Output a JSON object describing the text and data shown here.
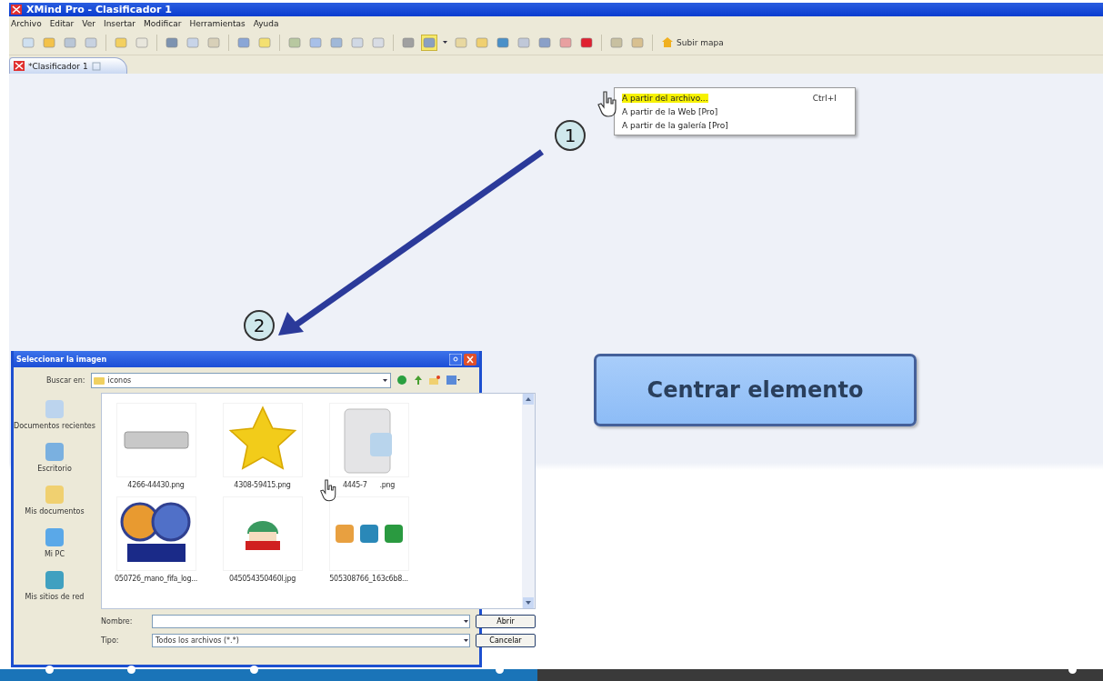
{
  "window": {
    "title": "XMind Pro - Clasificador 1"
  },
  "menu_bar": [
    "Archivo",
    "Editar",
    "Ver",
    "Insertar",
    "Modificar",
    "Herramientas",
    "Ayuda"
  ],
  "toolbar": {
    "image_button_selected": true,
    "subir_mapa": "Subir mapa"
  },
  "tabs": [
    {
      "label": "*Clasificador 1",
      "selected": true
    }
  ],
  "image_menu": {
    "items": [
      {
        "label": "A partir del archivo...",
        "shortcut": "Ctrl+I",
        "selected": true
      },
      {
        "label": "A partir de la Web [Pro]",
        "selected": false
      },
      {
        "label": "A partir de la galería [Pro]",
        "selected": false
      }
    ]
  },
  "callouts": [
    "1",
    "2"
  ],
  "topic": {
    "label": "Centrar elemento"
  },
  "dialog": {
    "title": "Seleccionar la imagen",
    "look_in_label": "Buscar en:",
    "folder": "iconos",
    "places": [
      "Documentos recientes",
      "Escritorio",
      "Mis documentos",
      "Mi PC",
      "Mis sitios de red"
    ],
    "files": [
      {
        "kind": "keyboard",
        "name": "4266-44430.png"
      },
      {
        "kind": "star",
        "name": "4308-59415.png"
      },
      {
        "kind": "printer",
        "name": "4445-7",
        "name_end": ".png"
      },
      {
        "kind": "fifa",
        "name": "050726_mano_fifa_log..."
      },
      {
        "kind": "cartoon",
        "name": "045054350460l.jpg"
      },
      {
        "kind": "social",
        "name": "505308766_163c6b8..."
      }
    ],
    "name_label": "Nombre:",
    "type_label": "Tipo:",
    "type_value": "Todos los archivos (*.*)",
    "buttons": [
      "Abrir",
      "Cancelar"
    ]
  },
  "player": {
    "progress": {
      "level": 0.487
    }
  }
}
